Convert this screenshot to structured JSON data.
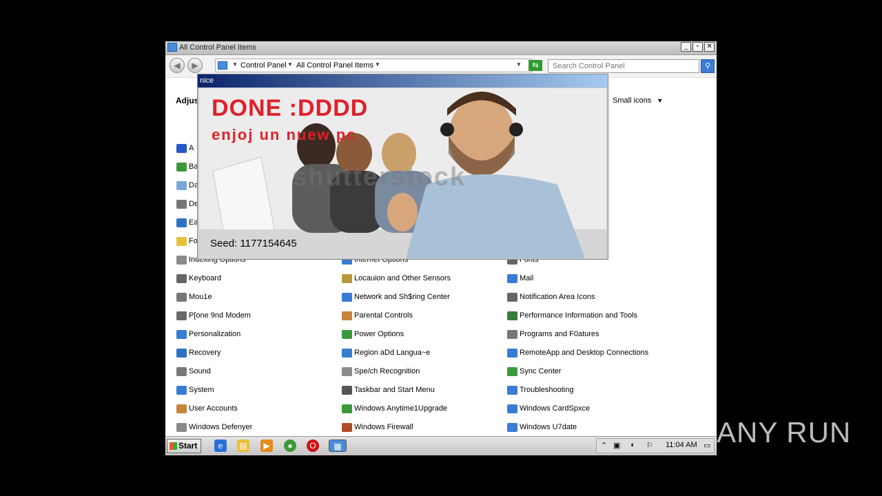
{
  "window": {
    "title": "All Control Panel Items"
  },
  "navigation": {
    "breadcrumbs": [
      "Control Panel",
      "All Control Panel Items"
    ],
    "search_placeholder": "Search Control Panel"
  },
  "content": {
    "heading": "Adjus",
    "view_by_value": "Small icons"
  },
  "items": [
    {
      "label": "A",
      "col": 0,
      "row": 0,
      "icon": "flag-icon",
      "color": "#2457c5"
    },
    {
      "label": "Ba",
      "col": 0,
      "row": 1,
      "icon": "backup-icon",
      "color": "#3a9a3a"
    },
    {
      "label": "Da",
      "col": 0,
      "row": 2,
      "icon": "clock-icon",
      "color": "#7aa7d8"
    },
    {
      "label": "De",
      "col": 0,
      "row": 3,
      "icon": "printer-icon",
      "color": "#777777"
    },
    {
      "label": "Ea",
      "col": 0,
      "row": 4,
      "icon": "ease-of-access-icon",
      "color": "#2f72c4"
    },
    {
      "label": "Fo",
      "col": 0,
      "row": 5,
      "icon": "folder-icon",
      "color": "#e8c03a"
    },
    {
      "label": "Indexing Options",
      "col": 0,
      "row": 6,
      "icon": "indexing-icon",
      "color": "#8a8a8a"
    },
    {
      "label": "Keyboard",
      "col": 0,
      "row": 7,
      "icon": "keyboard-icon",
      "color": "#666666"
    },
    {
      "label": "Mou1e",
      "col": 0,
      "row": 8,
      "icon": "mouse-icon",
      "color": "#777777"
    },
    {
      "label": "P[one 9nd Modem",
      "col": 0,
      "row": 9,
      "icon": "modem-icon",
      "color": "#6a6a6a"
    },
    {
      "label": "Personalization",
      "col": 0,
      "row": 10,
      "icon": "personalization-icon",
      "color": "#3a7bd5"
    },
    {
      "label": "Recovery",
      "col": 0,
      "row": 11,
      "icon": "recovery-icon",
      "color": "#2f72c4"
    },
    {
      "label": "Sound",
      "col": 0,
      "row": 12,
      "icon": "speaker-icon",
      "color": "#777777"
    },
    {
      "label": "System",
      "col": 0,
      "row": 13,
      "icon": "system-icon",
      "color": "#3a7bd5"
    },
    {
      "label": "User Accounts",
      "col": 0,
      "row": 14,
      "icon": "users-icon",
      "color": "#c8843a"
    },
    {
      "label": "Windows Defenyer",
      "col": 0,
      "row": 15,
      "icon": "defender-icon",
      "color": "#8a8a8a"
    },
    {
      "label": "Internet Options",
      "col": 1,
      "row": 6,
      "icon": "internet-icon",
      "color": "#3a7bd5"
    },
    {
      "label": "Locauion and Other Sensors",
      "col": 1,
      "row": 7,
      "icon": "sensors-icon",
      "color": "#b89a3a"
    },
    {
      "label": "Network and Sh$ring Center",
      "col": 1,
      "row": 8,
      "icon": "network-icon",
      "color": "#3a7bd5"
    },
    {
      "label": "Parental Controls",
      "col": 1,
      "row": 9,
      "icon": "parental-icon",
      "color": "#c8843a"
    },
    {
      "label": "Power Options",
      "col": 1,
      "row": 10,
      "icon": "power-icon",
      "color": "#3a9a3a"
    },
    {
      "label": "Region aDd Langua~e",
      "col": 1,
      "row": 11,
      "icon": "globe-icon",
      "color": "#3a7bd5"
    },
    {
      "label": "Spe/ch Recognition",
      "col": 1,
      "row": 12,
      "icon": "microphone-icon",
      "color": "#8a8a8a"
    },
    {
      "label": "Taskbar and Start Menu",
      "col": 1,
      "row": 13,
      "icon": "taskbar-icon",
      "color": "#555555"
    },
    {
      "label": "Windows Anytime1Upgrade",
      "col": 1,
      "row": 14,
      "icon": "upgrade-icon",
      "color": "#3a9a3a"
    },
    {
      "label": "Windows Firewall",
      "col": 1,
      "row": 15,
      "icon": "firewall-icon",
      "color": "#b04a2a"
    },
    {
      "label": "Fonts",
      "col": 2,
      "row": 6,
      "icon": "fonts-icon",
      "color": "#666666"
    },
    {
      "label": "Mail",
      "col": 2,
      "row": 7,
      "icon": "mail-icon",
      "color": "#3a7bd5"
    },
    {
      "label": "Notification Area Icons",
      "col": 2,
      "row": 8,
      "icon": "notification-icon",
      "color": "#666666"
    },
    {
      "label": "Performance Information and Tools",
      "col": 2,
      "row": 9,
      "icon": "performance-icon",
      "color": "#3a7a3a"
    },
    {
      "label": "Programs and F0atures",
      "col": 2,
      "row": 10,
      "icon": "programs-icon",
      "color": "#777777"
    },
    {
      "label": "RemoteApp and Desktop Connections",
      "col": 2,
      "row": 11,
      "icon": "remoteapp-icon",
      "color": "#3a7bd5"
    },
    {
      "label": "Sync Center",
      "col": 2,
      "row": 12,
      "icon": "sync-icon",
      "color": "#3a9a3a"
    },
    {
      "label": "Troubleshooting",
      "col": 2,
      "row": 13,
      "icon": "troubleshooting-icon",
      "color": "#3a7bd5"
    },
    {
      "label": "Windows CardSpxce",
      "col": 2,
      "row": 14,
      "icon": "cardspace-icon",
      "color": "#3a7bd5"
    },
    {
      "label": "Windows U7date",
      "col": 2,
      "row": 15,
      "icon": "update-icon",
      "color": "#3a7bd5"
    }
  ],
  "popup": {
    "title": "nice",
    "headline": "DONE :DDDD",
    "subline": "enjoj un nuew pc",
    "watermark": "shutterstock",
    "seed_label": "Seed: 1177154645"
  },
  "taskbar": {
    "start_label": "Start",
    "pinned": [
      "internet-explorer-icon",
      "explorer-icon",
      "media-player-icon",
      "chrome-icon",
      "opera-icon",
      "control-panel-icon"
    ],
    "clock": "11:04 AM"
  },
  "watermark": {
    "text": "ANY RUN"
  }
}
